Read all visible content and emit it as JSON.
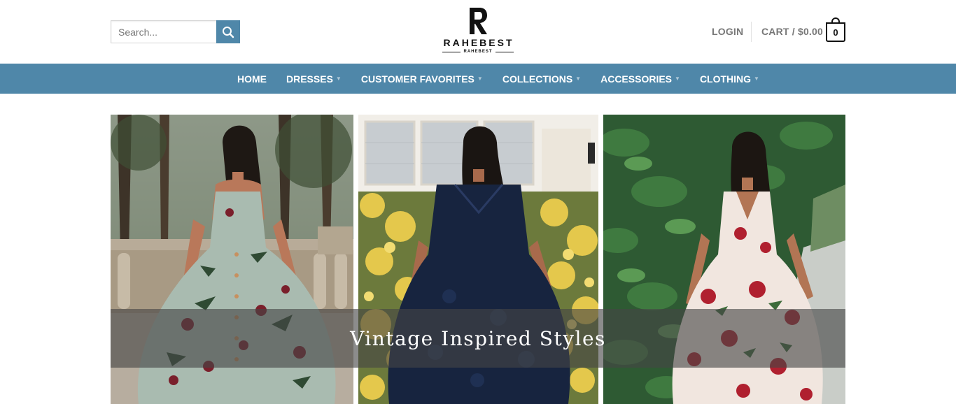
{
  "search": {
    "placeholder": "Search..."
  },
  "logo": {
    "name": "RAHEBEST",
    "sub": "RAHEBEST",
    "mark": "R"
  },
  "account": {
    "login_label": "LOGIN"
  },
  "cart": {
    "label": "CART / $0.00",
    "count": "0"
  },
  "nav": {
    "items": [
      {
        "label": "HOME",
        "has_dropdown": false
      },
      {
        "label": "DRESSES",
        "has_dropdown": true
      },
      {
        "label": "CUSTOMER FAVORITES",
        "has_dropdown": true
      },
      {
        "label": "COLLECTIONS",
        "has_dropdown": true
      },
      {
        "label": "ACCESSORIES",
        "has_dropdown": true
      },
      {
        "label": "CLOTHING",
        "has_dropdown": true
      }
    ]
  },
  "hero": {
    "caption": "Vintage Inspired Styles"
  },
  "colors": {
    "accent": "#4f87a9",
    "text_muted": "#777777"
  },
  "icons": {
    "search_button": "search-icon",
    "cart": "cart-bag-icon",
    "nav_dropdown": "chevron-down-icon"
  }
}
